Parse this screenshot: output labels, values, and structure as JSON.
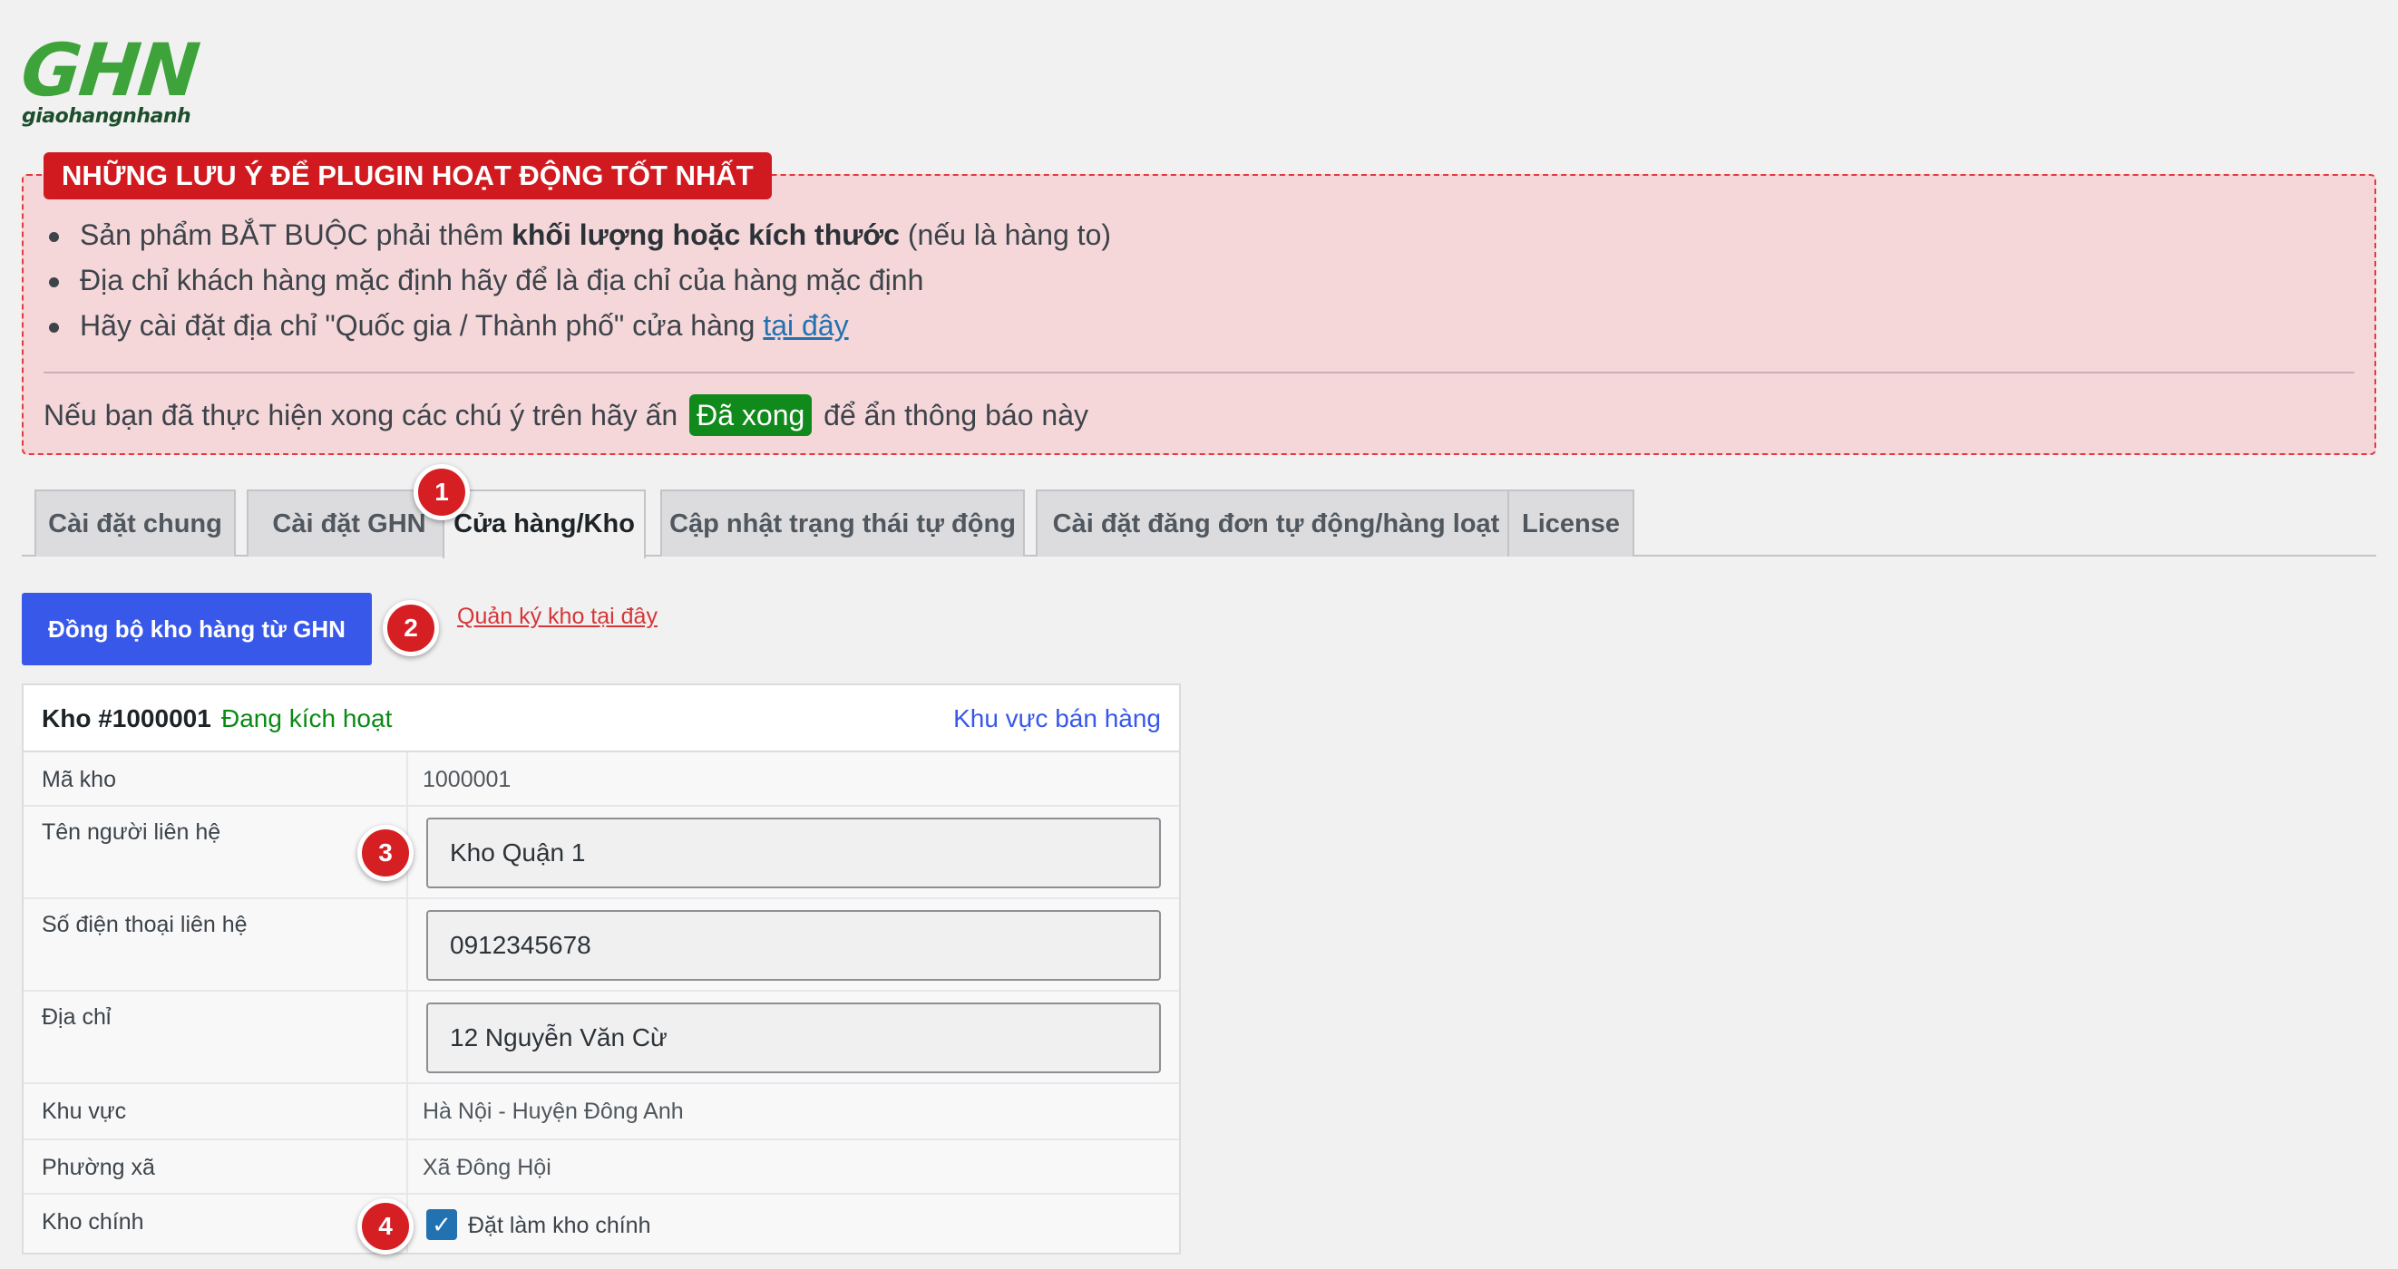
{
  "logo": {
    "main": "GHN",
    "sub": "giaohangnhanh"
  },
  "notice": {
    "title": "NHỮNG LƯU Ý ĐỂ PLUGIN HOẠT ĐỘNG TỐT NHẤT",
    "item1_pre": "Sản phẩm BẮT BUỘC phải thêm ",
    "item1_bold": "khối lượng hoặc kích thước",
    "item1_post": " (nếu là hàng to)",
    "item2": "Địa chỉ khách hàng mặc định hãy để là địa chỉ của hàng mặc định",
    "item3_pre": "Hãy cài đặt địa chỉ \"Quốc gia / Thành phố\" cửa hàng ",
    "item3_link": "tại đây",
    "footer_pre": "Nếu bạn đã thực hiện xong các chú ý trên hãy ấn",
    "done_label": "Đã xong",
    "footer_post": "để ẩn thông báo này",
    "colors": {
      "background": "#f5d7d9",
      "border": "#e53940",
      "title_bg": "#d11a1f"
    }
  },
  "tabs": [
    {
      "label": "Cài đặt chung"
    },
    {
      "label": "Cài đặt GHN"
    },
    {
      "label": "Cửa hàng/Kho",
      "active": true
    },
    {
      "label": "Cập nhật trạng thái tự động"
    },
    {
      "label": "Cài đặt đăng đơn tự động/hàng loạt"
    },
    {
      "label": "License"
    }
  ],
  "markers": [
    "1",
    "2",
    "3",
    "4"
  ],
  "sync_button": "Đồng bộ kho hàng từ GHN",
  "manage_link": "Quản ký kho tại đây",
  "warehouse": {
    "id": "Kho #1000001",
    "status": "Đang kích hoạt",
    "area_link": "Khu vực bán hàng",
    "rows": {
      "code": {
        "label": "Mã kho",
        "value": "1000001"
      },
      "contact_name": {
        "label": "Tên người liên hệ",
        "value": "Kho Quận 1"
      },
      "phone": {
        "label": "Số điện thoại liên hệ",
        "value": "0912345678"
      },
      "address": {
        "label": "Địa chỉ",
        "value": "12 Nguyễn Văn Cừ"
      },
      "region": {
        "label": "Khu vực",
        "value": "Hà Nội - Huyện Đông Anh"
      },
      "ward": {
        "label": "Phường xã",
        "value": "Xã Đông Hội"
      },
      "main": {
        "label": "Kho chính",
        "checkbox_label": "Đặt làm kho chính",
        "checked": true
      }
    }
  },
  "colors": {
    "primary": "#3858e9",
    "success": "#108a1a",
    "danger": "#d61f23",
    "logo_green": "#3da33a"
  }
}
